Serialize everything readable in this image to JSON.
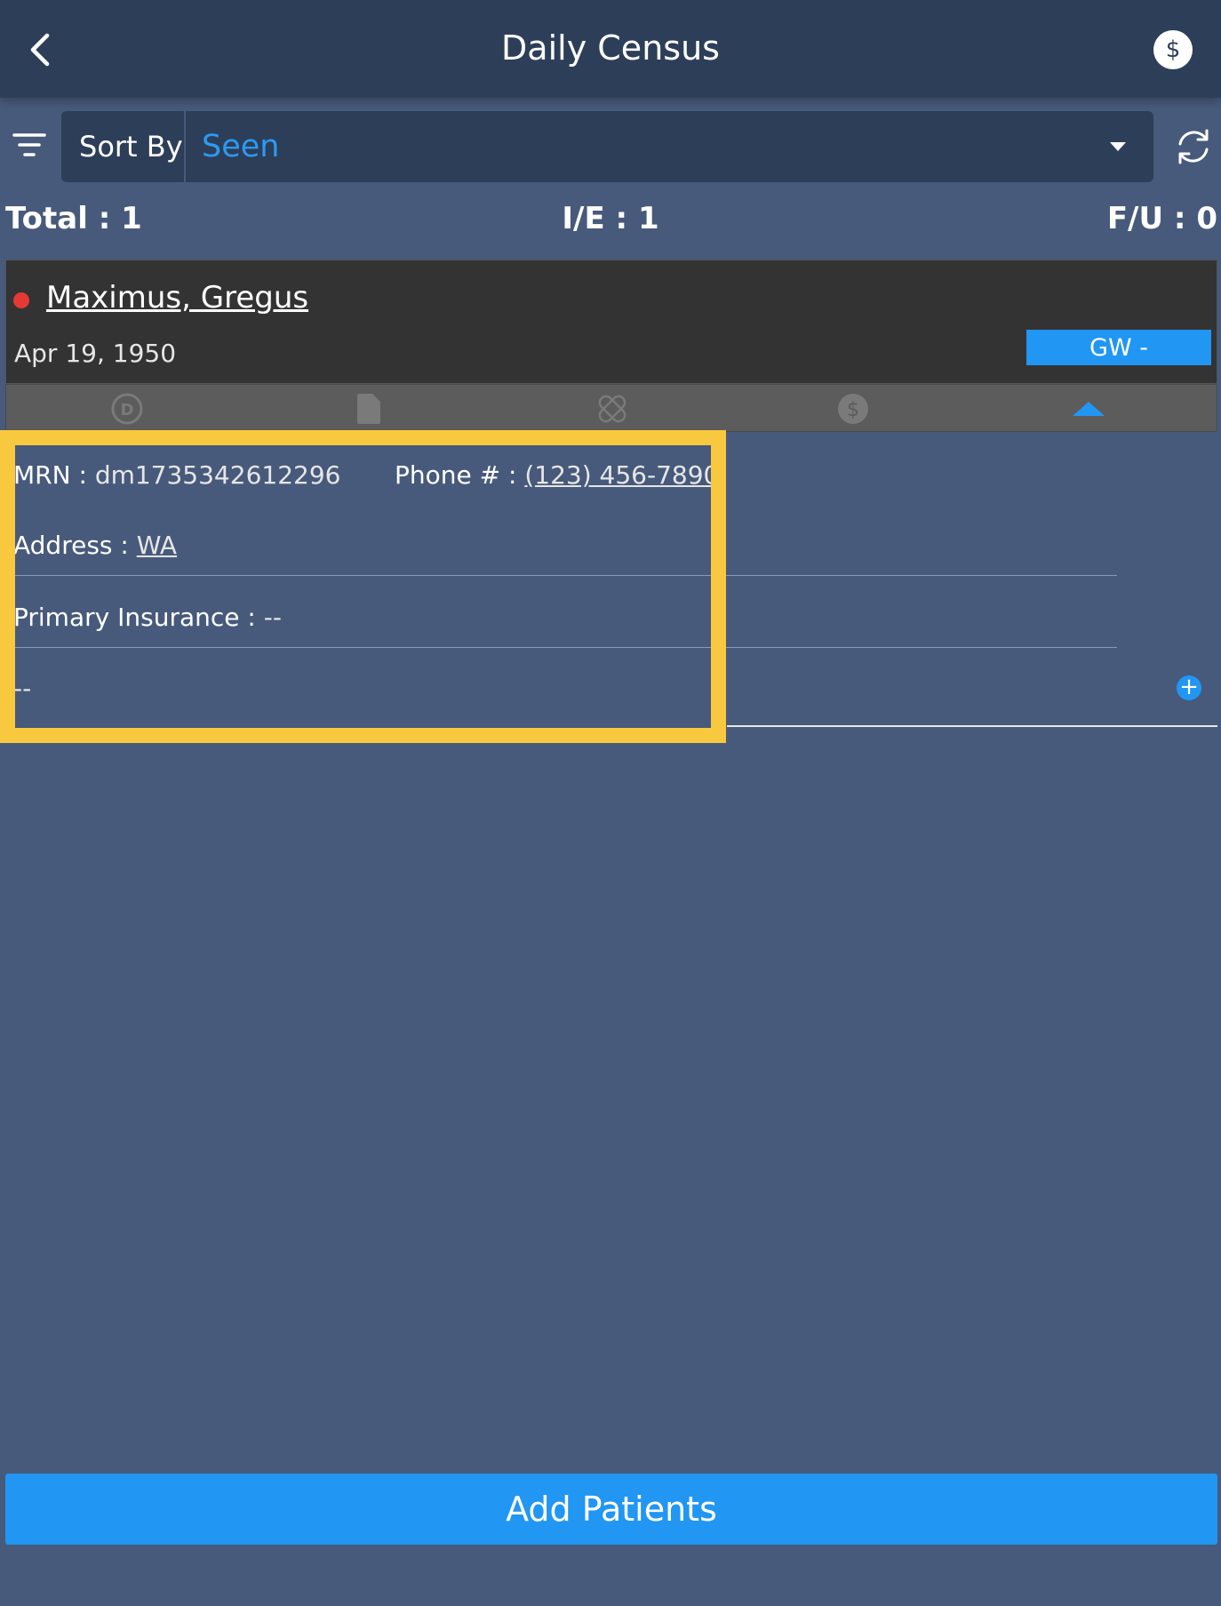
{
  "header": {
    "title": "Daily Census",
    "back_icon": "chevron-left-icon",
    "currency_icon": "dollar-icon",
    "currency_symbol": "$"
  },
  "sort": {
    "label": "Sort By",
    "selected": "Seen",
    "filter_icon": "filter-icon",
    "refresh_icon": "refresh-icon"
  },
  "counts": {
    "total": "Total : 1",
    "ie": "I/E : 1",
    "fu": "F/U : 0"
  },
  "patient": {
    "name": "Maximus, Gregus",
    "dob": "Apr 19, 1950",
    "location": "GW -",
    "status_color": "#e53935",
    "icons": [
      "diagnosis-icon",
      "document-icon",
      "bandage-icon",
      "billing-icon",
      "collapse-icon"
    ],
    "details": {
      "mrn_label": "MRN :",
      "mrn_value": "dm1735342612296",
      "phone_label": "Phone # :",
      "phone_value": "(123) 456-7890",
      "address_label": "Address :",
      "address_value": "WA",
      "insurance_label": "Primary Insurance :",
      "insurance_value": "--",
      "note": "--",
      "add_symbol": "+"
    }
  },
  "footer": {
    "add_label": "Add Patients"
  },
  "colors": {
    "background": "#475a7b",
    "header": "#2d3e59",
    "accent": "#2196f3",
    "highlight": "#f8c83f",
    "card": "#333333"
  }
}
